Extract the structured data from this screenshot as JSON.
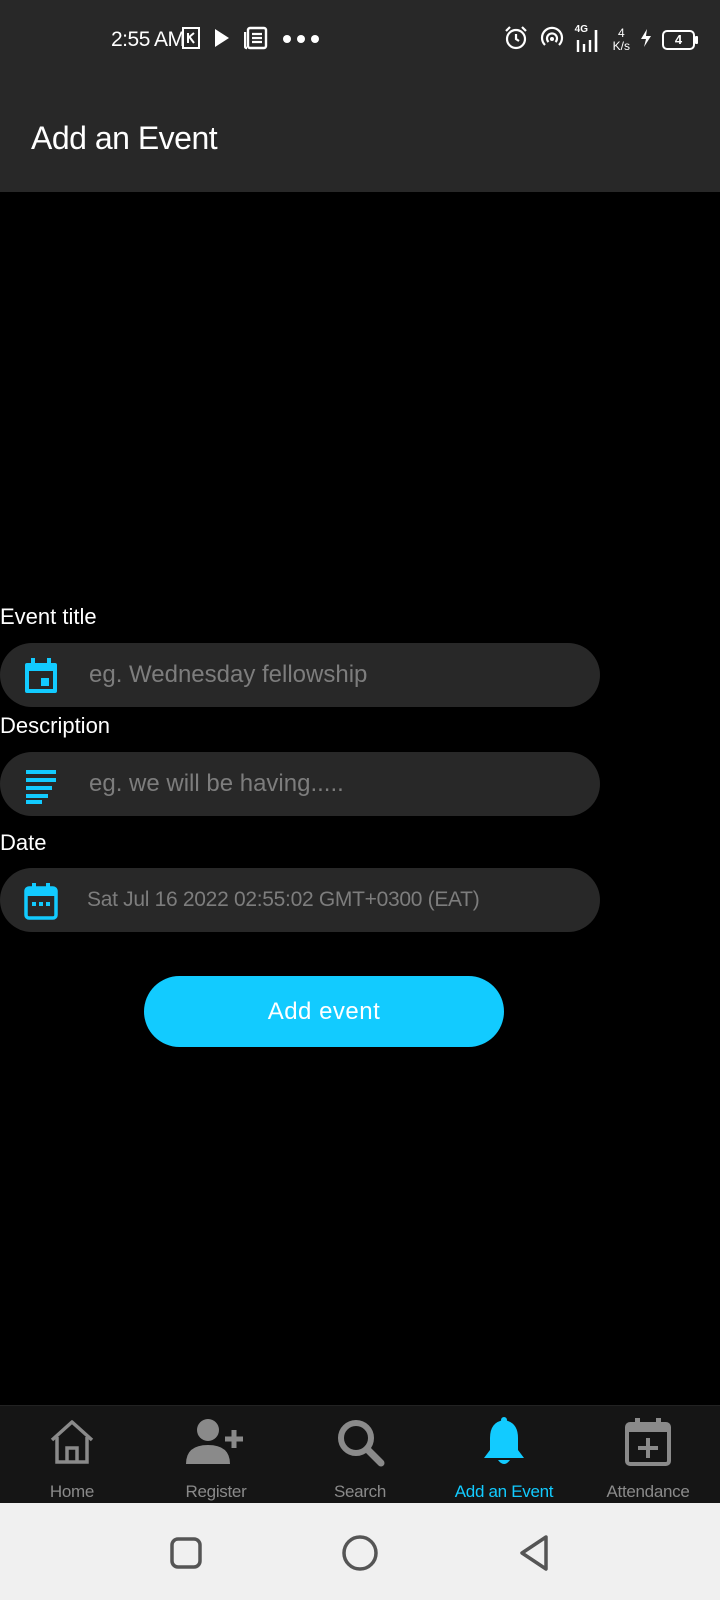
{
  "status_bar": {
    "time": "2:55 AM",
    "network_badge": "4G",
    "speed_value": "4",
    "speed_unit": "K/s",
    "battery": "4",
    "icons": [
      "k-app-icon",
      "play-icon",
      "news-icon",
      "more-dots-icon",
      "alarm-icon",
      "hotspot-icon",
      "signal-icon",
      "charging-icon",
      "battery-icon"
    ]
  },
  "app_bar": {
    "title": "Add an Event"
  },
  "form": {
    "title_label": "Event title",
    "title_placeholder": "eg. Wednesday fellowship",
    "description_label": "Description",
    "description_placeholder": "eg. we will be having.....",
    "date_label": "Date",
    "date_value": "Sat Jul 16 2022 02:55:02 GMT+0300 (EAT)",
    "submit_label": "Add event"
  },
  "bottom_nav": {
    "items": [
      {
        "label": "Home",
        "icon": "home-icon",
        "active": false
      },
      {
        "label": "Register",
        "icon": "add-user-icon",
        "active": false
      },
      {
        "label": "Search",
        "icon": "search-icon",
        "active": false
      },
      {
        "label": "Add an Event",
        "icon": "bell-icon",
        "active": true
      },
      {
        "label": "Attendance",
        "icon": "calendar-plus-icon",
        "active": false
      }
    ]
  },
  "colors": {
    "accent": "#12cbff",
    "bar_background": "#282828",
    "page_background": "#000000",
    "field_background": "#282828",
    "inactive": "#8a8a8a"
  }
}
